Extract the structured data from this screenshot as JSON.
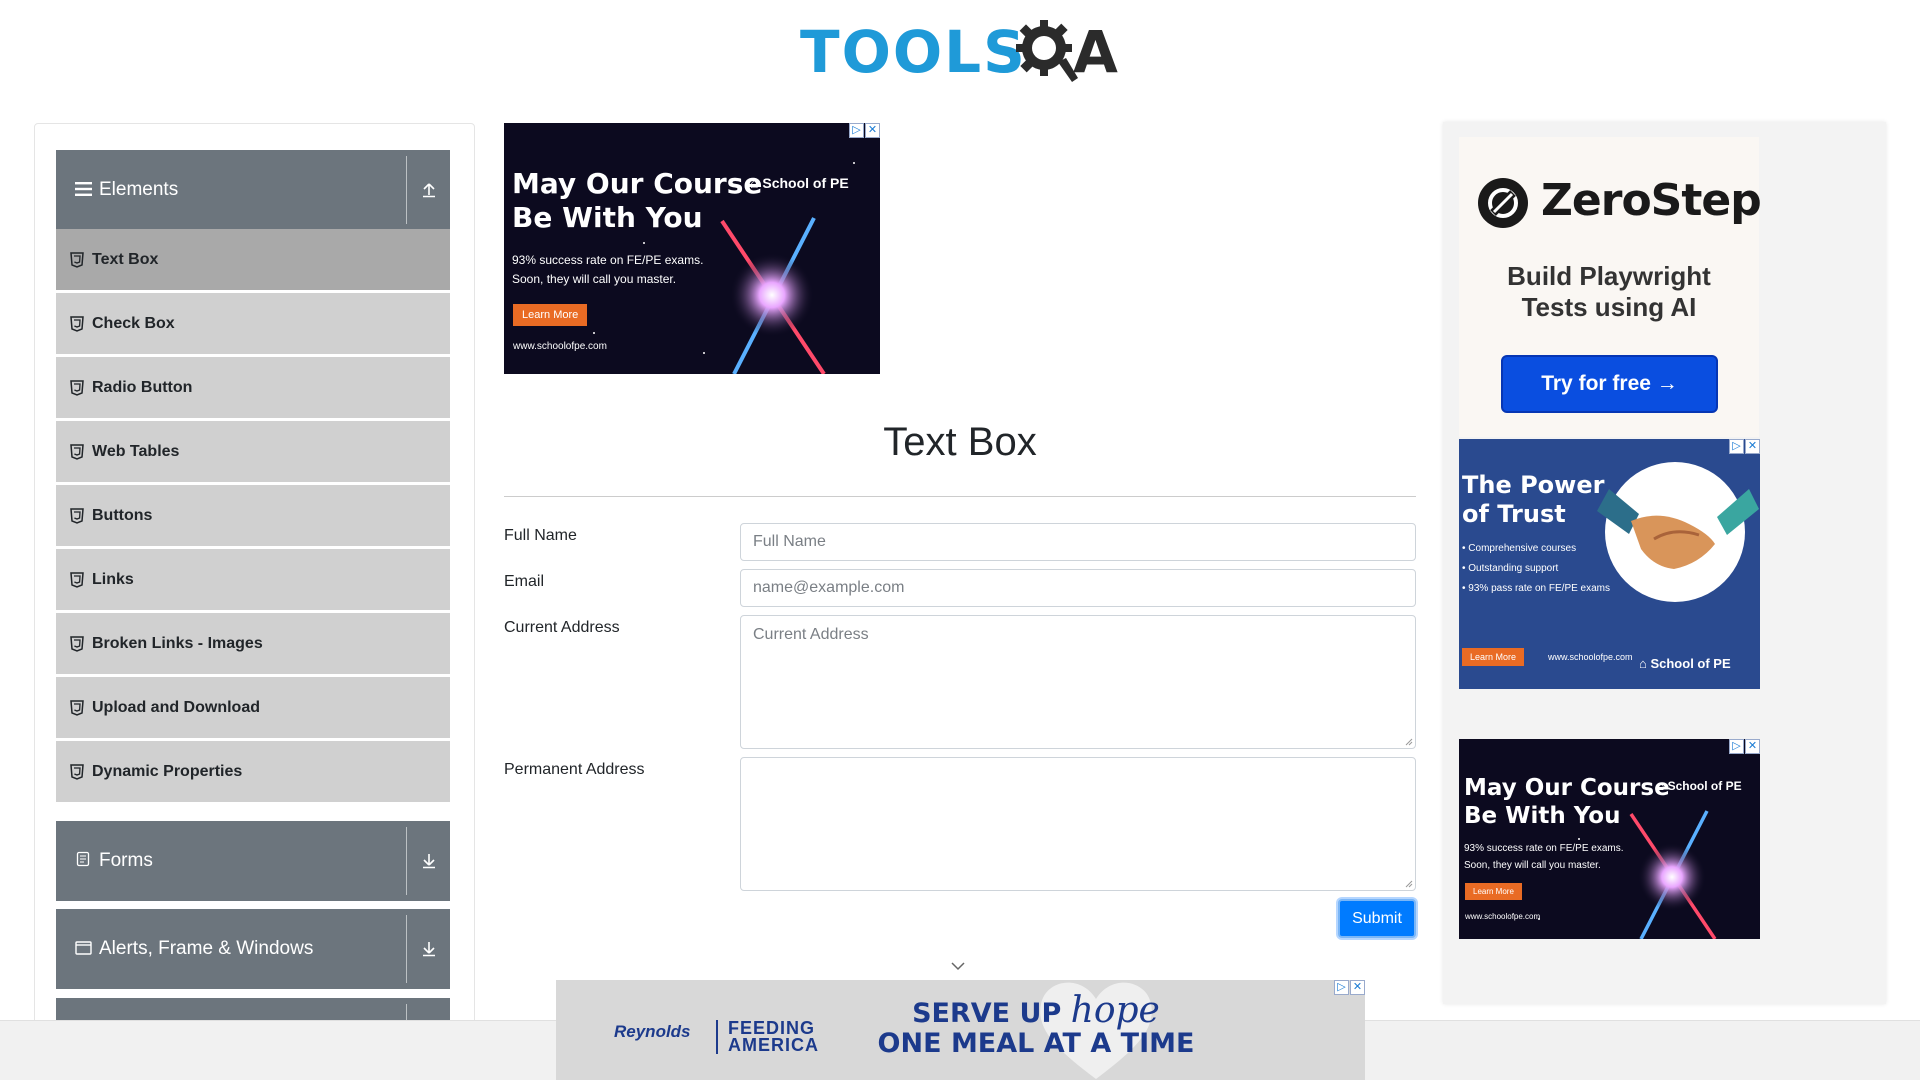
{
  "header": {
    "logo_text": "TOOLS",
    "logo_letter": "A",
    "logo_alt": "TOOLSQA"
  },
  "colors": {
    "brand_blue": "#1f9ad8",
    "sidebar_header": "#6c757d",
    "menu_item": "#d0d0d0",
    "menu_item_active": "#a9a9a9",
    "primary": "#007bff"
  },
  "sidebar": {
    "groups": [
      {
        "label": "Elements",
        "icon": "hamburger-icon",
        "toggle_icon": "collapse-up-icon",
        "expanded": true
      },
      {
        "label": "Forms",
        "icon": "form-icon",
        "toggle_icon": "expand-down-icon",
        "expanded": false
      },
      {
        "label": "Alerts, Frame & Windows",
        "icon": "window-icon",
        "toggle_icon": "expand-down-icon",
        "expanded": false
      }
    ],
    "items": [
      {
        "label": "Text Box",
        "active": true
      },
      {
        "label": "Check Box"
      },
      {
        "label": "Radio Button"
      },
      {
        "label": "Web Tables"
      },
      {
        "label": "Buttons"
      },
      {
        "label": "Links"
      },
      {
        "label": "Broken Links - Images"
      },
      {
        "label": "Upload and Download"
      },
      {
        "label": "Dynamic Properties"
      }
    ]
  },
  "main": {
    "title": "Text Box",
    "form": {
      "full_name": {
        "label": "Full Name",
        "placeholder": "Full Name",
        "value": ""
      },
      "email": {
        "label": "Email",
        "placeholder": "name@example.com",
        "value": ""
      },
      "current_address": {
        "label": "Current Address",
        "placeholder": "Current Address",
        "value": ""
      },
      "permanent_address": {
        "label": "Permanent Address",
        "placeholder": "",
        "value": ""
      },
      "submit_label": "Submit"
    }
  },
  "ads": {
    "top": {
      "heading_line1": "May Our Course",
      "heading_line2": "Be With You",
      "sub_line1": "93% success rate on FE/PE exams.",
      "sub_line2": "Soon, they will call you master.",
      "brand": "School of PE",
      "button": "Learn More",
      "url": "www.schoolofpe.com"
    },
    "zerostep": {
      "brand": "ZeroStep",
      "tagline_line1": "Build Playwright",
      "tagline_line2": "Tests using AI",
      "button": "Try for free →"
    },
    "trust": {
      "heading_line1": "The Power",
      "heading_line2": "of Trust",
      "bullet1": "Comprehensive courses",
      "bullet2": "Outstanding support",
      "bullet3": "93% pass rate on FE/PE exams",
      "button": "Learn More",
      "url": "www.schoolofpe.com",
      "brand": "School of PE"
    },
    "stars2": {
      "heading_line1": "May Our Course",
      "heading_line2": "Be With You",
      "sub_line1": "93% success rate on FE/PE exams.",
      "sub_line2": "Soon, they will call you master.",
      "brand": "School of PE",
      "button": "Learn More",
      "url": "www.schoolofpe.com"
    },
    "bottom": {
      "sponsor": "Reynolds",
      "partner_line1": "FEEDING",
      "partner_line2": "AMERICA",
      "slogan_line1a": "SERVE UP ",
      "slogan_hope": "hope",
      "slogan_line2": "ONE MEAL AT A TIME"
    }
  }
}
